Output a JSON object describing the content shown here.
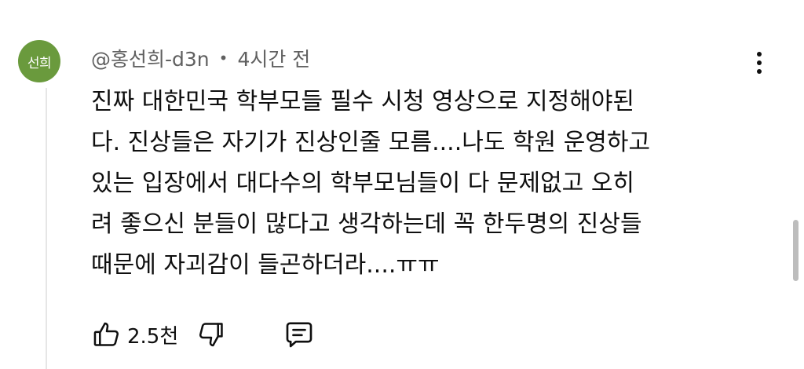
{
  "comment": {
    "avatar_text": "선희",
    "author": "@홍선희-d3n",
    "separator": "•",
    "time": "4시간 전",
    "lines": [
      "진짜 대한민국 학부모들 필수 시청 영상으로 지정해야된",
      "다. 진상들은 자기가 진상인줄 모름....나도 학원 운영하고",
      "있는 입장에서 대다수의 학부모님들이 다 문제없고 오히",
      "려 좋으신 분들이 많다고 생각하는데 꼭 한두명의 진상들",
      "때문에 자괴감이 들곤하더라....ㅠㅠ"
    ],
    "like_count": "2.5천"
  },
  "colors": {
    "avatar_bg": "#6a9a3d",
    "text": "#0f0f0f",
    "meta_text": "#606060"
  },
  "icons": [
    "more-vert-icon",
    "thumb-up-icon",
    "thumb-down-icon",
    "comment-reply-icon"
  ]
}
